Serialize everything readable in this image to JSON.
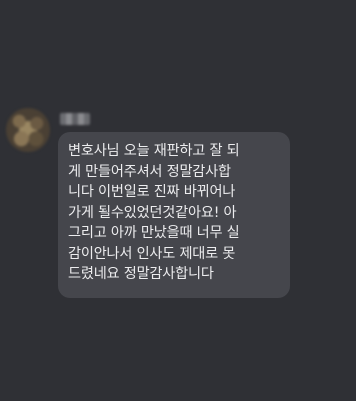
{
  "message": {
    "sender_name": "",
    "lines": [
      "변호사님 오늘 재판하고 잘 되",
      "게 만들어주셔서 정말감사합",
      "니다 이번일로 진짜 바뀌어나",
      "가게 될수있었던것같아요! 아",
      "그리고 아까 만났을때 너무 실",
      "감이안나서 인사도 제대로 못",
      "드렸네요 정말감사합니다"
    ]
  },
  "colors": {
    "background": "#2f3035",
    "bubble": "#45464c",
    "text": "#ececee"
  }
}
